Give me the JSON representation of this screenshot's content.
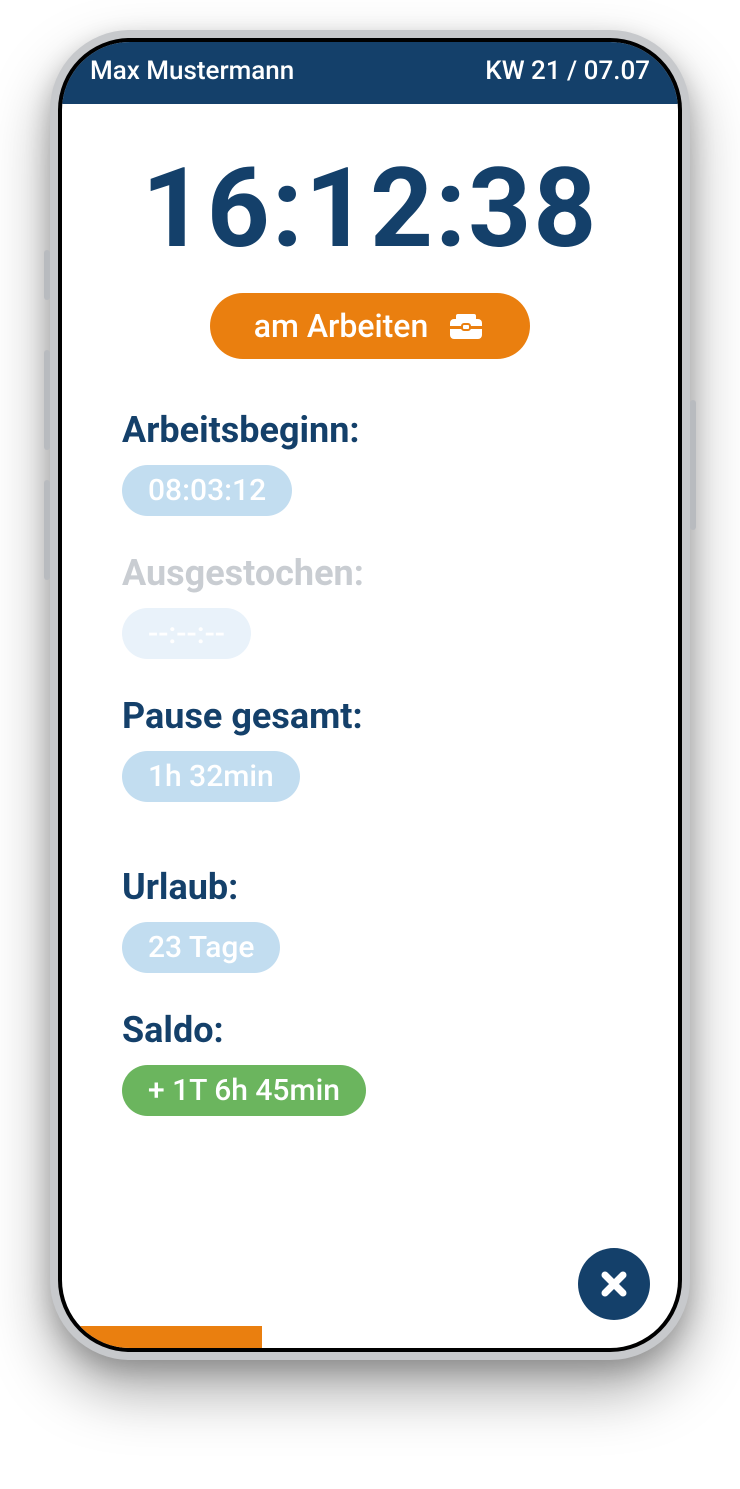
{
  "header": {
    "user_name": "Max Mustermann",
    "date_label": "KW 21 / 07.07"
  },
  "clock": "16:12:38",
  "status": {
    "label": "am Arbeiten"
  },
  "sections": {
    "work_start": {
      "label": "Arbeitsbeginn:",
      "value": "08:03:12"
    },
    "clock_out": {
      "label": "Ausgestochen:",
      "value": "--:--:--"
    },
    "pause_total": {
      "label": "Pause gesamt:",
      "value": "1h 32min"
    },
    "vacation": {
      "label": "Urlaub:",
      "value": "23 Tage"
    },
    "balance": {
      "label": "Saldo:",
      "value": "+ 1T 6h 45min"
    }
  },
  "colors": {
    "brand_dark": "#14406a",
    "accent_orange": "#ea7f0f",
    "pill_light": "#c2ddf0",
    "balance_green": "#6bb55e"
  }
}
